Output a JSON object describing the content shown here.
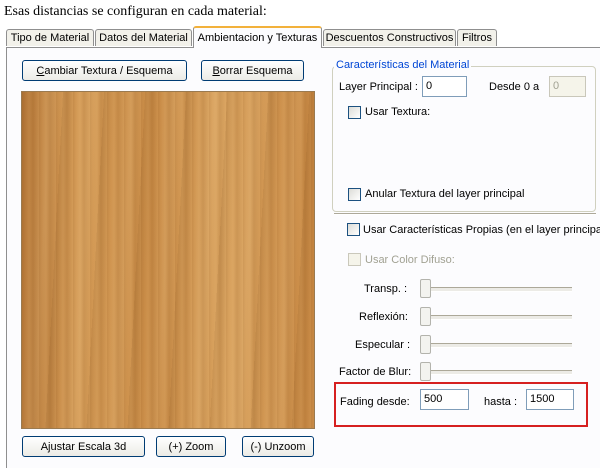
{
  "caption": "Esas distancias se configuran en cada material:",
  "tabs": [
    {
      "label": "Tipo de Material",
      "active": false
    },
    {
      "label": "Datos del Material",
      "active": false
    },
    {
      "label": "Ambientacion y Texturas",
      "active": true
    },
    {
      "label": "Descuentos Constructivos",
      "active": false
    },
    {
      "label": "Filtros",
      "active": false
    }
  ],
  "left_panel": {
    "change_texture_label_hotkey": "C",
    "change_texture_label_rest": "ambiar Textura / Esquema",
    "delete_scheme_label_hotkey": "B",
    "delete_scheme_label_rest": "orrar Esquema",
    "texture_preview": "wood-texture-image",
    "adjust_scale_label": "Ajustar Escala 3d",
    "zoom_in_label": "(+) Zoom",
    "zoom_out_label": "(-) Unzoom"
  },
  "material_group": {
    "title": "Características del Material",
    "layer_principal_label": "Layer Principal :",
    "layer_principal_value": "0",
    "desde_label": "Desde 0 a",
    "desde_value": "0",
    "usar_textura_label": "Usar Textura:",
    "anular_textura_label": "Anular Textura del layer principal"
  },
  "properties": {
    "usar_caracteristicas_label": "Usar Características Propias (en el layer principal)",
    "usar_color_difuso_label": "Usar Color Difuso:",
    "transp_label": "Transp. :",
    "reflexion_label": "Reflexión:",
    "especular_label": "Especular :",
    "factor_blur_label": "Factor de Blur:"
  },
  "fading": {
    "desde_label": "Fading desde:",
    "desde_value": "500",
    "hasta_label": "hasta :",
    "hasta_value": "1500"
  },
  "colors": {
    "active_tab_accent": "#f2b13b",
    "group_title": "#0046d5",
    "highlight_border": "#d62020",
    "wood_base": "#c98c45"
  }
}
